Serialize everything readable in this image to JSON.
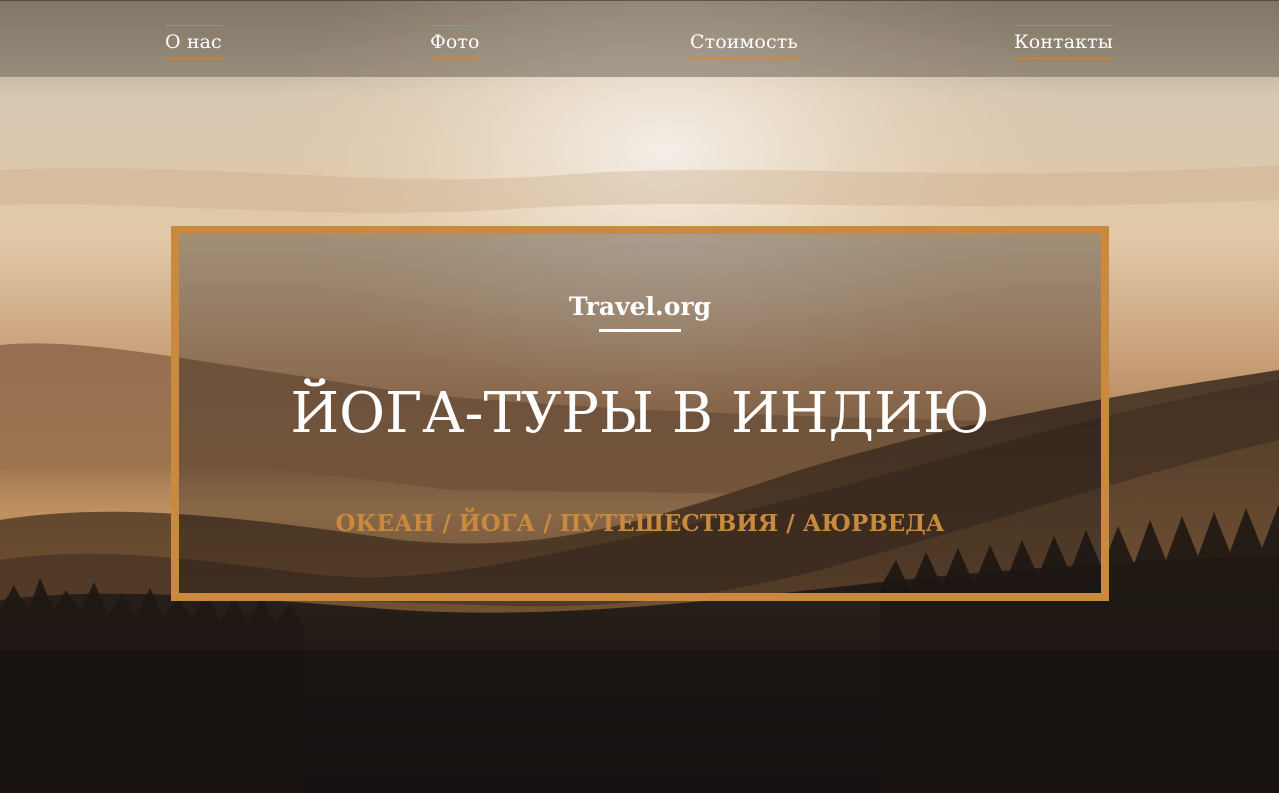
{
  "nav": {
    "items": [
      {
        "label": "О нас"
      },
      {
        "label": "Фото"
      },
      {
        "label": "Стоимость"
      },
      {
        "label": "Контакты"
      }
    ]
  },
  "hero": {
    "site_name": "Travel.org",
    "headline": "ЙОГА-ТУРЫ В ИНДИЮ",
    "tagline": "ОКЕАН / ЙОГА / ПУТЕШЕСТВИЯ / АЮРВЕДА",
    "background_image": "sunset-over-misty-forested-hills"
  },
  "colors": {
    "accent": "#c98a3e",
    "text": "#ffffff",
    "nav_bar": "#6e645a"
  }
}
